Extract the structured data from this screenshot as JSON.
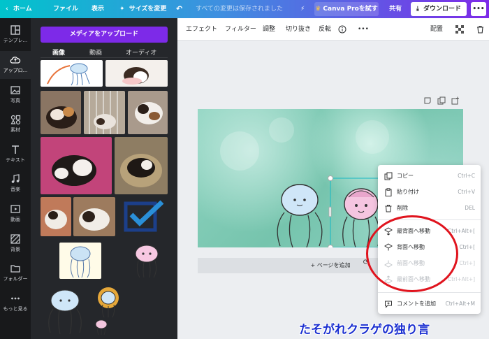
{
  "topbar": {
    "home": "ホーム",
    "file": "ファイル",
    "view": "表示",
    "resize": "サイズを変更",
    "status": "すべての変更は保存されました",
    "pro": "Canva Proを試す",
    "share": "共有",
    "download": "ダウンロード",
    "more": "•••"
  },
  "rail": [
    {
      "label": "テンプレ...",
      "icon": "template-icon"
    },
    {
      "label": "アップロ...",
      "icon": "upload-icon"
    },
    {
      "label": "写真",
      "icon": "photo-icon"
    },
    {
      "label": "素材",
      "icon": "elements-icon"
    },
    {
      "label": "テキスト",
      "icon": "text-icon"
    },
    {
      "label": "音楽",
      "icon": "music-icon"
    },
    {
      "label": "動画",
      "icon": "video-icon"
    },
    {
      "label": "背景",
      "icon": "background-icon"
    },
    {
      "label": "フォルダー",
      "icon": "folder-icon"
    },
    {
      "label": "もっと見る",
      "icon": "more-icon"
    }
  ],
  "panel": {
    "upload_button": "メディアをアップロード",
    "tabs": [
      "画像",
      "動画",
      "オーディオ"
    ]
  },
  "toolbar": {
    "effect": "エフェクト",
    "filter": "フィルター",
    "adjust": "調整",
    "crop": "切り抜き",
    "flip": "反転",
    "more": "•••",
    "position": "配置"
  },
  "canvas": {
    "add_page": "+ ページを追加"
  },
  "context_menu": {
    "items": [
      {
        "label": "コピー",
        "shortcut": "Ctrl+C",
        "icon": "copy-icon",
        "disabled": false
      },
      {
        "label": "貼り付け",
        "shortcut": "Ctrl+V",
        "icon": "paste-icon",
        "disabled": false
      },
      {
        "label": "削除",
        "shortcut": "DEL",
        "icon": "trash-icon",
        "disabled": false
      },
      {
        "label": "最背面へ移動",
        "shortcut": "Ctrl+Alt+[",
        "icon": "send-to-back-icon",
        "disabled": false
      },
      {
        "label": "背面へ移動",
        "shortcut": "Ctrl+[",
        "icon": "send-backward-icon",
        "disabled": false
      },
      {
        "label": "前面へ移動",
        "shortcut": "Ctrl+]",
        "icon": "bring-forward-icon",
        "disabled": true
      },
      {
        "label": "最前面へ移動",
        "shortcut": "Ctrl+Alt+]",
        "icon": "bring-to-front-icon",
        "disabled": true
      },
      {
        "label": "コメントを追加",
        "shortcut": "Ctrl+Alt+M",
        "icon": "comment-icon",
        "disabled": false
      }
    ]
  },
  "watermark": "たそがれクラゲの独り言",
  "colors": {
    "brand_purple": "#7d2ae8",
    "brand_teal": "#00c4cc",
    "highlight_red": "#e0141e"
  }
}
